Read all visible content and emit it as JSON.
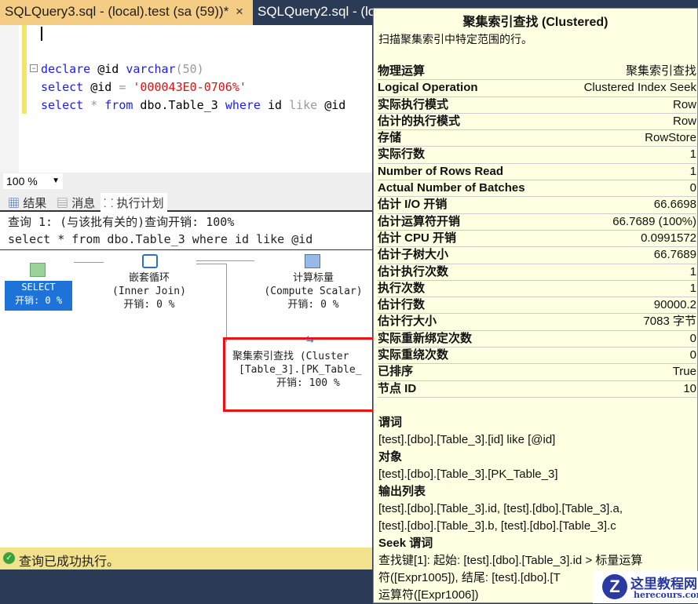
{
  "tabs": [
    {
      "label": "SQLQuery3.sql - (local).test (sa (59))*",
      "close": "×"
    },
    {
      "label": "SQLQuery2.sql - (lo"
    }
  ],
  "editor": {
    "line1": {
      "kw1": "declare",
      "v": " @id ",
      "kw2": "varchar",
      "rest": "(50)"
    },
    "line2": {
      "kw": "select",
      "v": " @id ",
      "op": "=",
      "str": " '000043E0-0706%'"
    },
    "line3": {
      "kw1": "select",
      "star": " * ",
      "kw2": "from",
      "t": " dbo.Table_3 ",
      "kw3": "where",
      "id": " id ",
      "like": "like",
      "v": " @id"
    }
  },
  "zoom": {
    "value": "100 %"
  },
  "result_tabs": [
    "结果",
    "消息",
    "执行计划"
  ],
  "plan": {
    "header1": "查询 1: (与该批有关的)查询开销: 100%",
    "header2": "select * from dbo.Table_3 where id like @id",
    "nodes": [
      {
        "l1": "SELECT",
        "l2": "开销: 0 %"
      },
      {
        "l1": "嵌套循环",
        "l2": "(Inner Join)",
        "l3": "开销: 0 %"
      },
      {
        "l1": "计算标量",
        "l2": "(Compute Scalar)",
        "l3": "开销: 0 %"
      },
      {
        "l1": "聚集索引查找 (Cluster",
        "l2": "[Table_3].[PK_Table_",
        "l3": "开销: 100 %"
      }
    ]
  },
  "status": "查询已成功执行。",
  "tooltip": {
    "title": "聚集索引查找 (Clustered)",
    "desc": "扫描聚集索引中特定范围的行。",
    "props": [
      [
        "物理运算",
        "聚集索引查找"
      ],
      [
        "Logical Operation",
        "Clustered Index Seek"
      ],
      [
        "实际执行模式",
        "Row"
      ],
      [
        "估计的执行模式",
        "Row"
      ],
      [
        "存储",
        "RowStore"
      ],
      [
        "实际行数",
        "1"
      ],
      [
        "Number of Rows Read",
        "1"
      ],
      [
        "Actual Number of Batches",
        "0"
      ],
      [
        "估计 I/O 开销",
        "66.6698"
      ],
      [
        "估计运算符开销",
        "66.7689 (100%)"
      ],
      [
        "估计 CPU 开销",
        "0.0991572"
      ],
      [
        "估计子树大小",
        "66.7689"
      ],
      [
        "估计执行次数",
        "1"
      ],
      [
        "执行次数",
        "1"
      ],
      [
        "估计行数",
        "90000.2"
      ],
      [
        "估计行大小",
        "7083 字节"
      ],
      [
        "实际重新绑定次数",
        "0"
      ],
      [
        "实际重绕次数",
        "0"
      ],
      [
        "已排序",
        "True"
      ],
      [
        "节点 ID",
        "10"
      ]
    ],
    "predicate_label": "谓词",
    "predicate": "[test].[dbo].[Table_3].[id] like [@id]",
    "object_label": "对象",
    "object": "[test].[dbo].[Table_3].[PK_Table_3]",
    "output_label": "输出列表",
    "output1": "[test].[dbo].[Table_3].id, [test].[dbo].[Table_3].a,",
    "output2": "[test].[dbo].[Table_3].b, [test].[dbo].[Table_3].c",
    "seek_label": "Seek 谓词",
    "seek1": "查找键[1]: 起始: [test].[dbo].[Table_3].id  > 标量运算",
    "seek2": "符([Expr1005]), 结尾: [test].[dbo].[T",
    "seek3": "运算符([Expr1006])"
  },
  "watermark": {
    "title": "这里教程网",
    "site": "herecours.com"
  }
}
